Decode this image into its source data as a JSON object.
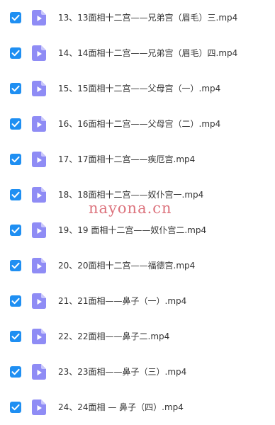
{
  "files": [
    {
      "name": "13、13面相十二宫——兄弟宫（眉毛）三.mp4",
      "checked": true,
      "icon": "video-file-icon"
    },
    {
      "name": "14、14面相十二宫——兄弟宫（眉毛）四.mp4",
      "checked": true,
      "icon": "video-file-icon"
    },
    {
      "name": "15、15面相十二宫——父母宫（一）.mp4",
      "checked": true,
      "icon": "video-file-icon"
    },
    {
      "name": "16、16面相十二宫——父母宫（二）.mp4",
      "checked": true,
      "icon": "video-file-icon"
    },
    {
      "name": "17、17面相十二宫——疾厄宫.mp4",
      "checked": true,
      "icon": "video-file-icon"
    },
    {
      "name": "18、18面相十二宫——奴仆宫一.mp4",
      "checked": true,
      "icon": "video-file-icon"
    },
    {
      "name": "19、19 面相十二宫——奴仆宫二.mp4",
      "checked": true,
      "icon": "video-file-icon"
    },
    {
      "name": "20、20面相十二宫——福德宫.mp4",
      "checked": true,
      "icon": "video-file-icon"
    },
    {
      "name": "21、21面相——鼻子（一）.mp4",
      "checked": true,
      "icon": "video-file-icon"
    },
    {
      "name": "22、22面相——鼻子二.mp4",
      "checked": true,
      "icon": "video-file-icon"
    },
    {
      "name": "23、23面相——鼻子（三）.mp4",
      "checked": true,
      "icon": "video-file-icon"
    },
    {
      "name": "24、24面相 — 鼻子（四）.mp4",
      "checked": true,
      "icon": "video-file-icon"
    }
  ],
  "watermark": "nayona.cn",
  "colors": {
    "checkbox": "#1f8ff2",
    "file_icon": "#8f8cf5",
    "file_icon_fold": "#c9c7fb",
    "text": "#333333",
    "watermark": "#d65a66"
  }
}
